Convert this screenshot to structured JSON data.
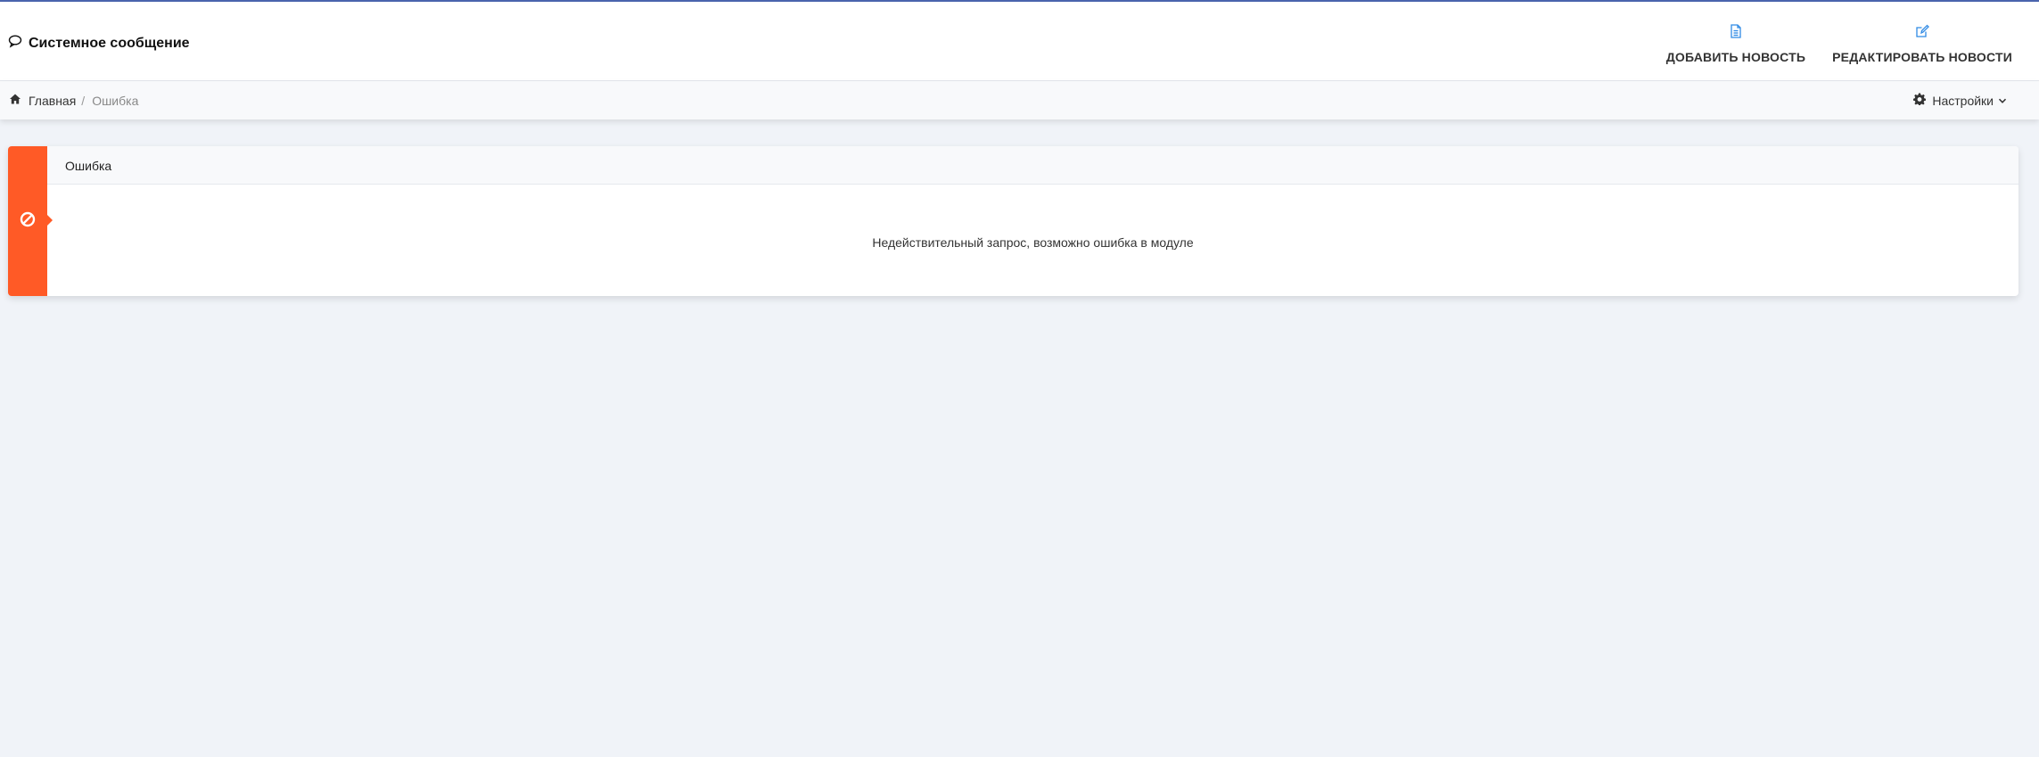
{
  "header": {
    "title": "Системное сообщение",
    "title_icon": "comment-icon",
    "actions": [
      {
        "label": "ДОБАВИТЬ НОВОСТЬ",
        "icon": "file-icon"
      },
      {
        "label": "РЕДАКТИРОВАТЬ НОВОСТИ",
        "icon": "edit-icon"
      }
    ]
  },
  "breadcrumb": {
    "home": "Главная",
    "separator": "/",
    "current": "Ошибка"
  },
  "settings": {
    "label": "Настройки"
  },
  "panel": {
    "title": "Ошибка",
    "message": "Недействительный запрос, возможно ошибка в модуле",
    "icon": "ban-icon"
  },
  "colors": {
    "accent": "#4a64ad",
    "error": "#ff5a26",
    "action_icon": "#2f8ae5"
  }
}
